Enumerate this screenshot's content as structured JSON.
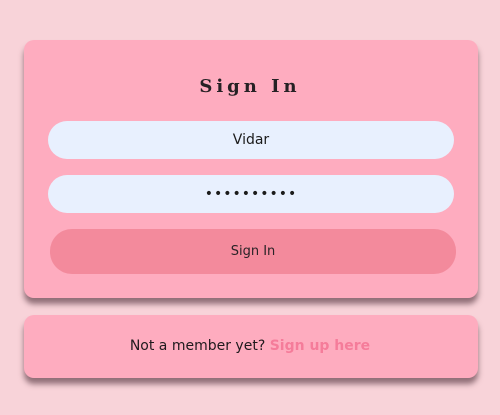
{
  "signin": {
    "title": "Sign In",
    "username_value": "Vidar",
    "password_value": "••••••••••",
    "submit_label": "Sign In"
  },
  "signup": {
    "prompt": "Not a member yet?",
    "link_label": "Sign up here"
  },
  "colors": {
    "page_background": "#f8d3d9",
    "card_background": "#feacbf",
    "input_background": "#e8f0fe",
    "button_background": "#f38a9c",
    "link_color": "#f57c9a"
  }
}
